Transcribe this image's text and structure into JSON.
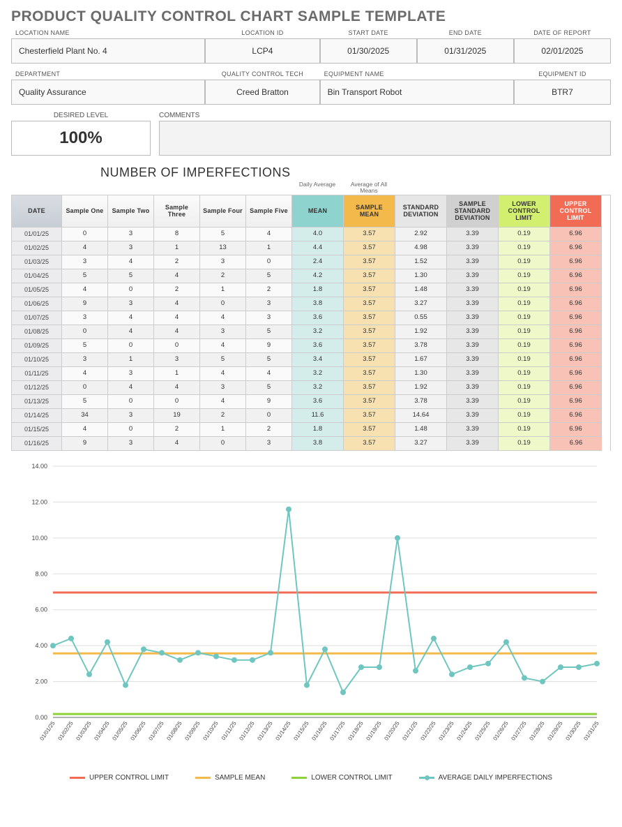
{
  "title": "PRODUCT QUALITY CONTROL CHART SAMPLE TEMPLATE",
  "header1_labels": {
    "location_name": "LOCATION NAME",
    "location_id": "LOCATION ID",
    "start_date": "START DATE",
    "end_date": "END DATE",
    "date_report": "DATE OF REPORT"
  },
  "header1_values": {
    "location_name": "Chesterfield Plant No. 4",
    "location_id": "LCP4",
    "start_date": "01/30/2025",
    "end_date": "01/31/2025",
    "date_report": "02/01/2025"
  },
  "header2_labels": {
    "department": "DEPARTMENT",
    "qc_tech": "QUALITY CONTROL TECH",
    "equip_name": "EQUIPMENT NAME",
    "equip_id": "EQUIPMENT ID"
  },
  "header2_values": {
    "department": "Quality Assurance",
    "qc_tech": "Creed Bratton",
    "equip_name": "Bin Transport Robot",
    "equip_id": "BTR7"
  },
  "desired_level_label": "DESIRED LEVEL",
  "desired_level_value": "100%",
  "comments_label": "COMMENTS",
  "section_title": "NUMBER OF IMPERFECTIONS",
  "sub_daily_avg": "Daily Average",
  "sub_avg_means": "Average of All Means",
  "columns": {
    "date": "DATE",
    "s1": "Sample One",
    "s2": "Sample Two",
    "s3": "Sample Three",
    "s4": "Sample Four",
    "s5": "Sample Five",
    "mean": "MEAN",
    "smean": "SAMPLE MEAN",
    "sd": "STANDARD DEVIATION",
    "ssd": "SAMPLE STANDARD DEVIATION",
    "lcl": "LOWER CONTROL LIMIT",
    "ucl": "UPPER CONTROL LIMIT"
  },
  "rows": [
    {
      "date": "01/01/25",
      "s": [
        0,
        3,
        8,
        5,
        4
      ],
      "mean": "4.0",
      "smean": "3.57",
      "sd": "2.92",
      "ssd": "3.39",
      "lcl": "0.19",
      "ucl": "6.96"
    },
    {
      "date": "01/02/25",
      "s": [
        4,
        3,
        1,
        13,
        1
      ],
      "mean": "4.4",
      "smean": "3.57",
      "sd": "4.98",
      "ssd": "3.39",
      "lcl": "0.19",
      "ucl": "6.96"
    },
    {
      "date": "01/03/25",
      "s": [
        3,
        4,
        2,
        3,
        0
      ],
      "mean": "2.4",
      "smean": "3.57",
      "sd": "1.52",
      "ssd": "3.39",
      "lcl": "0.19",
      "ucl": "6.96"
    },
    {
      "date": "01/04/25",
      "s": [
        5,
        5,
        4,
        2,
        5
      ],
      "mean": "4.2",
      "smean": "3.57",
      "sd": "1.30",
      "ssd": "3.39",
      "lcl": "0.19",
      "ucl": "6.96"
    },
    {
      "date": "01/05/25",
      "s": [
        4,
        0,
        2,
        1,
        2
      ],
      "mean": "1.8",
      "smean": "3.57",
      "sd": "1.48",
      "ssd": "3.39",
      "lcl": "0.19",
      "ucl": "6.96"
    },
    {
      "date": "01/06/25",
      "s": [
        9,
        3,
        4,
        0,
        3
      ],
      "mean": "3.8",
      "smean": "3.57",
      "sd": "3.27",
      "ssd": "3.39",
      "lcl": "0.19",
      "ucl": "6.96"
    },
    {
      "date": "01/07/25",
      "s": [
        3,
        4,
        4,
        4,
        3
      ],
      "mean": "3.6",
      "smean": "3.57",
      "sd": "0.55",
      "ssd": "3.39",
      "lcl": "0.19",
      "ucl": "6.96"
    },
    {
      "date": "01/08/25",
      "s": [
        0,
        4,
        4,
        3,
        5
      ],
      "mean": "3.2",
      "smean": "3.57",
      "sd": "1.92",
      "ssd": "3.39",
      "lcl": "0.19",
      "ucl": "6.96"
    },
    {
      "date": "01/09/25",
      "s": [
        5,
        0,
        0,
        4,
        9
      ],
      "mean": "3.6",
      "smean": "3.57",
      "sd": "3.78",
      "ssd": "3.39",
      "lcl": "0.19",
      "ucl": "6.96"
    },
    {
      "date": "01/10/25",
      "s": [
        3,
        1,
        3,
        5,
        5
      ],
      "mean": "3.4",
      "smean": "3.57",
      "sd": "1.67",
      "ssd": "3.39",
      "lcl": "0.19",
      "ucl": "6.96"
    },
    {
      "date": "01/11/25",
      "s": [
        4,
        3,
        1,
        4,
        4
      ],
      "mean": "3.2",
      "smean": "3.57",
      "sd": "1.30",
      "ssd": "3.39",
      "lcl": "0.19",
      "ucl": "6.96"
    },
    {
      "date": "01/12/25",
      "s": [
        0,
        4,
        4,
        3,
        5
      ],
      "mean": "3.2",
      "smean": "3.57",
      "sd": "1.92",
      "ssd": "3.39",
      "lcl": "0.19",
      "ucl": "6.96"
    },
    {
      "date": "01/13/25",
      "s": [
        5,
        0,
        0,
        4,
        9
      ],
      "mean": "3.6",
      "smean": "3.57",
      "sd": "3.78",
      "ssd": "3.39",
      "lcl": "0.19",
      "ucl": "6.96"
    },
    {
      "date": "01/14/25",
      "s": [
        34,
        3,
        19,
        2,
        0
      ],
      "mean": "11.6",
      "smean": "3.57",
      "sd": "14.64",
      "ssd": "3.39",
      "lcl": "0.19",
      "ucl": "6.96"
    },
    {
      "date": "01/15/25",
      "s": [
        4,
        0,
        2,
        1,
        2
      ],
      "mean": "1.8",
      "smean": "3.57",
      "sd": "1.48",
      "ssd": "3.39",
      "lcl": "0.19",
      "ucl": "6.96"
    },
    {
      "date": "01/16/25",
      "s": [
        9,
        3,
        4,
        0,
        3
      ],
      "mean": "3.8",
      "smean": "3.57",
      "sd": "3.27",
      "ssd": "3.39",
      "lcl": "0.19",
      "ucl": "6.96"
    }
  ],
  "legend": {
    "ucl": "UPPER CONTROL LIMIT",
    "sm": "SAMPLE MEAN",
    "lcl": "LOWER CONTROL LIMIT",
    "adi": "AVERAGE DAILY IMPERFECTIONS"
  },
  "chart_data": {
    "type": "line",
    "title": "",
    "xlabel": "",
    "ylabel": "",
    "ylim": [
      0,
      14
    ],
    "yticks": [
      0,
      2,
      4,
      6,
      8,
      10,
      12,
      14
    ],
    "categories": [
      "01/01/25",
      "01/02/25",
      "01/03/25",
      "01/04/25",
      "01/05/25",
      "01/06/25",
      "01/07/25",
      "01/08/25",
      "01/09/25",
      "01/10/25",
      "01/11/25",
      "01/12/25",
      "01/13/25",
      "01/14/25",
      "01/15/25",
      "01/16/25",
      "01/17/25",
      "01/18/25",
      "01/19/25",
      "01/20/25",
      "01/21/25",
      "01/22/25",
      "01/23/25",
      "01/24/25",
      "01/25/25",
      "01/26/25",
      "01/27/25",
      "01/28/25",
      "01/29/25",
      "01/30/25",
      "01/31/25"
    ],
    "series": [
      {
        "name": "UPPER CONTROL LIMIT",
        "values": 6.96,
        "constant": true,
        "color": "#f26c55"
      },
      {
        "name": "SAMPLE MEAN",
        "values": 3.57,
        "constant": true,
        "color": "#f3b94a"
      },
      {
        "name": "LOWER CONTROL LIMIT",
        "values": 0.19,
        "constant": true,
        "color": "#8cd23a"
      },
      {
        "name": "AVERAGE DAILY IMPERFECTIONS",
        "values": [
          4.0,
          4.4,
          2.4,
          4.2,
          1.8,
          3.8,
          3.6,
          3.2,
          3.6,
          3.4,
          3.2,
          3.2,
          3.6,
          11.6,
          1.8,
          3.8,
          1.4,
          2.8,
          2.8,
          10.0,
          2.6,
          4.4,
          2.4,
          2.8,
          3.0,
          4.2,
          2.2,
          2.0,
          2.8,
          2.8,
          3.0
        ],
        "constant": false,
        "color": "#6fc6c0"
      }
    ]
  }
}
